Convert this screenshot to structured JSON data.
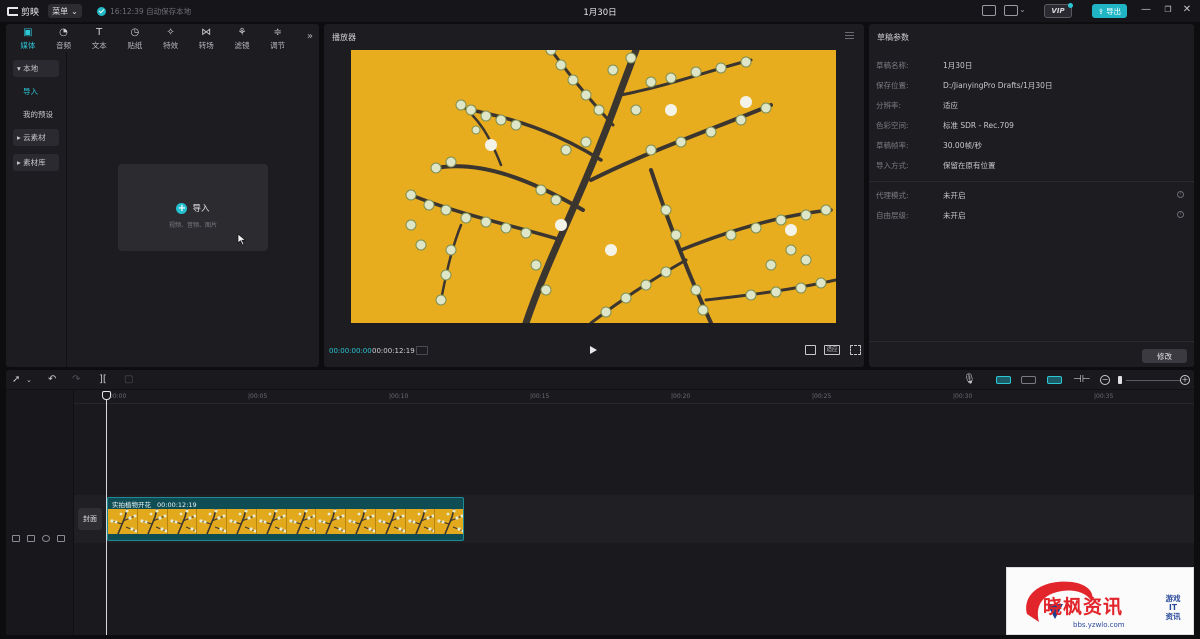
{
  "titlebar": {
    "app_name": "剪映",
    "menu_label": "菜单",
    "save_status": "16:12:39 自动保存本地",
    "doc_title": "1月30日",
    "vip_label": "VIP",
    "export_label": "导出"
  },
  "media_panel": {
    "tabs": [
      {
        "label": "媒体",
        "icon": "media-icon"
      },
      {
        "label": "音频",
        "icon": "audio-icon"
      },
      {
        "label": "文本",
        "icon": "text-icon"
      },
      {
        "label": "贴纸",
        "icon": "sticker-icon"
      },
      {
        "label": "特效",
        "icon": "effects-icon"
      },
      {
        "label": "转场",
        "icon": "transition-icon"
      },
      {
        "label": "滤镜",
        "icon": "filter-icon"
      },
      {
        "label": "调节",
        "icon": "adjust-icon"
      }
    ],
    "side_nav": {
      "local": "▾ 本地",
      "import": "导入",
      "presets": "我的预设",
      "cloud": "▸ 云素材",
      "library": "▸ 素材库"
    },
    "import_box": {
      "label": "导入",
      "hint": "视频、音频、图片"
    }
  },
  "player": {
    "title": "播放器",
    "current_time": "00:00:00:00",
    "duration": "00:00:12:19",
    "ratio_label": "适应"
  },
  "properties": {
    "title": "草稿参数",
    "rows": [
      {
        "label": "草稿名称:",
        "value": "1月30日"
      },
      {
        "label": "保存位置:",
        "value": "D:/JianyingPro Drafts/1月30日"
      },
      {
        "label": "分辨率:",
        "value": "适应"
      },
      {
        "label": "色彩空间:",
        "value": "标准 SDR - Rec.709"
      },
      {
        "label": "草稿帧率:",
        "value": "30.00帧/秒"
      },
      {
        "label": "导入方式:",
        "value": "保留在原有位置"
      }
    ],
    "extra_rows": [
      {
        "label": "代理模式:",
        "value": "未开启"
      },
      {
        "label": "自由层级:",
        "value": "未开启"
      }
    ],
    "edit_label": "修改"
  },
  "timeline": {
    "ruler_ticks": [
      "00:00",
      "|00:05",
      "|00:10",
      "|00:15",
      "|00:20",
      "|00:25",
      "|00:30",
      "|00:35"
    ],
    "clip": {
      "name": "实拍植物开花",
      "duration": "00:00:12:19"
    },
    "cover_label": "封面"
  },
  "watermark": {
    "main": "晓枫资讯",
    "side_1": "游戏",
    "side_2": "IT",
    "side_3": "资讯",
    "url": "bbs.yzwlo.com"
  },
  "colors": {
    "accent": "#2dc6d5",
    "video_bg": "#e8ac1f",
    "clip_bg": "#0f4d55"
  }
}
